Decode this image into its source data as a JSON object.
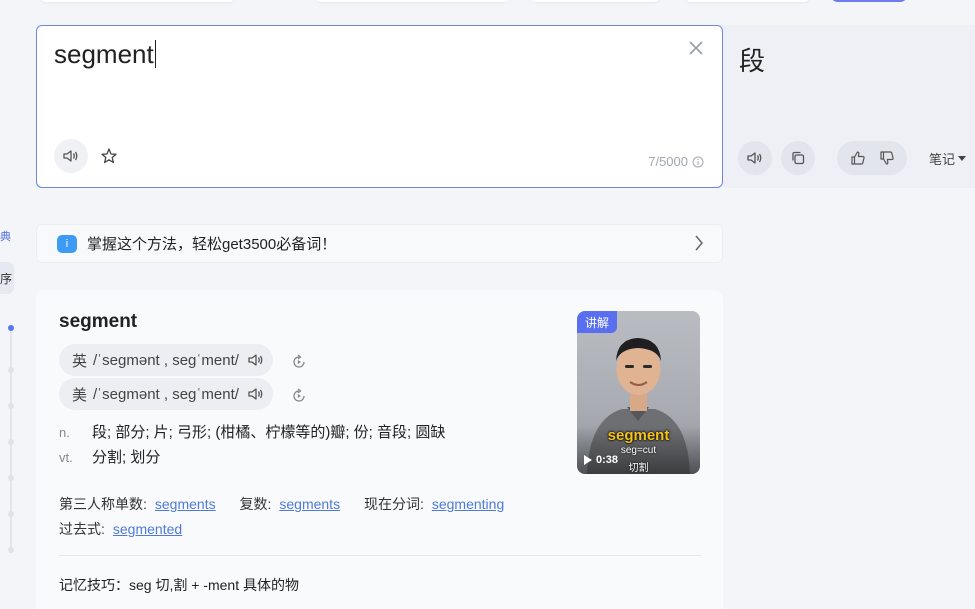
{
  "input": {
    "text": "segment",
    "char_count": "7/5000"
  },
  "result": {
    "text": "段",
    "notes_label": "笔记"
  },
  "left_rail": {
    "dict_label": "典",
    "tab_label": "序"
  },
  "promo": {
    "text": "掌握这个方法，轻松get3500必备词！",
    "icon_text": "i"
  },
  "dictionary": {
    "word": "segment",
    "pronunciations": [
      {
        "label": "英",
        "ipa": "/ˈseɡmənt , seɡˈment/"
      },
      {
        "label": "美",
        "ipa": "/ˈseɡmənt , seɡˈment/"
      }
    ],
    "definitions": [
      {
        "pos": "n.",
        "meaning": "段;  部分;  片;  弓形;  (柑橘、柠檬等的)瓣;  份;  音段;  圆缺"
      },
      {
        "pos": "vt.",
        "meaning": "分割;  划分"
      }
    ],
    "forms": [
      {
        "label": "第三人称单数:",
        "value": "segments"
      },
      {
        "label": "复数:",
        "value": "segments"
      },
      {
        "label": "现在分词:",
        "value": "segmenting"
      },
      {
        "label": "过去式:",
        "value": "segmented"
      }
    ],
    "mnemonic": "记忆技巧：seg 切,割 + -ment 具体的物",
    "video": {
      "tag": "讲解",
      "caption": "segment",
      "sub1": "seg=cut",
      "sub2": "切割",
      "duration": "0:38"
    }
  },
  "colors": {
    "accent": "#5a6ff0",
    "link": "#4f7ad8",
    "border_focus": "#6d86e8"
  }
}
